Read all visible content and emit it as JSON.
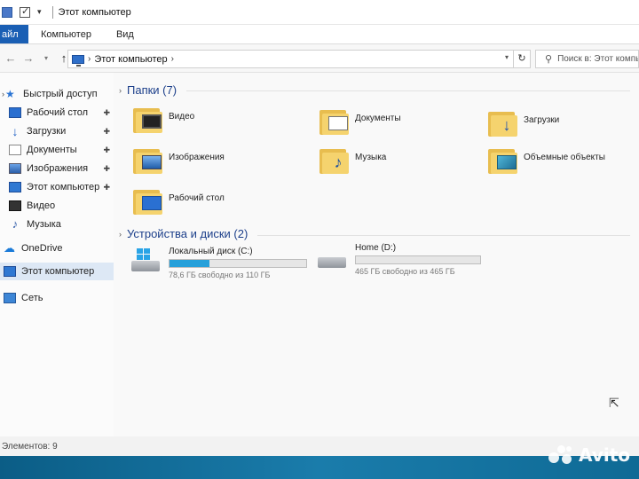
{
  "window": {
    "title": "Этот компьютер"
  },
  "ribbon": {
    "file": "айл",
    "tabs": [
      "Компьютер",
      "Вид"
    ]
  },
  "address": {
    "crumb": "Этот компьютер",
    "search_placeholder": "Поиск в: Этот компьют"
  },
  "sidebar": {
    "items": [
      {
        "label": "Быстрый доступ",
        "icon": "star-icon"
      },
      {
        "label": "Рабочий стол",
        "icon": "desktop-icon"
      },
      {
        "label": "Загрузки",
        "icon": "download-icon"
      },
      {
        "label": "Документы",
        "icon": "document-icon"
      },
      {
        "label": "Изображения",
        "icon": "image-icon"
      },
      {
        "label": "Этот компьютер",
        "icon": "computer-icon"
      },
      {
        "label": "Видео",
        "icon": "video-icon"
      },
      {
        "label": "Музыка",
        "icon": "music-icon"
      },
      {
        "label": "OneDrive",
        "icon": "cloud-icon"
      },
      {
        "label": "Этот компьютер",
        "icon": "computer-icon"
      },
      {
        "label": "Сеть",
        "icon": "network-icon"
      }
    ]
  },
  "folders": {
    "title": "Папки (7)",
    "items": [
      {
        "label": "Видео",
        "icon": "video-folder-icon"
      },
      {
        "label": "Документы",
        "icon": "documents-folder-icon"
      },
      {
        "label": "Загрузки",
        "icon": "downloads-folder-icon"
      },
      {
        "label": "Изображения",
        "icon": "pictures-folder-icon"
      },
      {
        "label": "Музыка",
        "icon": "music-folder-icon"
      },
      {
        "label": "Объемные объекты",
        "icon": "3d-objects-folder-icon"
      },
      {
        "label": "Рабочий стол",
        "icon": "desktop-folder-icon"
      }
    ]
  },
  "devices": {
    "title": "Устройства и диски (2)",
    "drives": [
      {
        "name": "Локальный диск (C:)",
        "free": "78,6 ГБ свободно из 110 ГБ",
        "used_fraction": 0.29,
        "icon": "windows-drive-icon"
      },
      {
        "name": "Home (D:)",
        "free": "465 ГБ свободно из 465 ГБ",
        "used_fraction": 0.0,
        "icon": "drive-icon"
      }
    ]
  },
  "status": {
    "text": "Элементов: 9"
  },
  "watermark": {
    "text": "Avito"
  },
  "colors": {
    "accent": "#1a5fb4",
    "group_title": "#1c3f8a",
    "drive_fill": "#26a0da"
  }
}
